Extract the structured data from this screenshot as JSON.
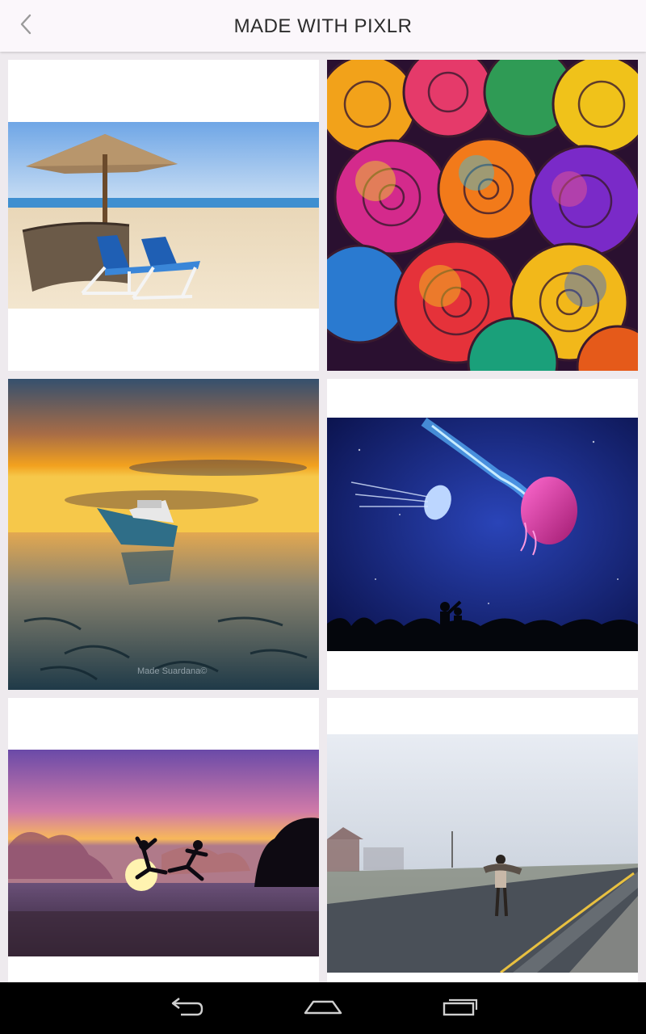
{
  "appbar": {
    "title": "MADE WITH PIXLR",
    "back_icon": "chevron-left-icon"
  },
  "gallery": {
    "items": [
      {
        "subject": "beach umbrella and lounge chairs"
      },
      {
        "subject": "rainbow roses"
      },
      {
        "subject": "boat at sunset on tidal flats",
        "watermark": "Made Suardana©"
      },
      {
        "subject": "jellyfish in night sky with silhouettes"
      },
      {
        "subject": "silhouettes jumping at sunset beach"
      },
      {
        "subject": "couple on foggy road"
      }
    ]
  },
  "navbar": {
    "back_icon": "back-arrow-icon",
    "home_icon": "home-icon",
    "recents_icon": "recent-apps-icon"
  },
  "colors": {
    "appbar_bg": "#fbf7fb",
    "page_bg": "#eeeaee",
    "tile_bg": "#ffffff",
    "navbar_bg": "#000000"
  }
}
